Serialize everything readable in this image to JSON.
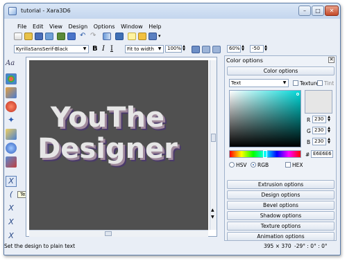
{
  "window": {
    "title": "tutorial - Xara3D6"
  },
  "menu": [
    "File",
    "Edit",
    "View",
    "Design",
    "Options",
    "Window",
    "Help"
  ],
  "format_bar": {
    "font": "KyrillaSansSerif-Black",
    "bold": "B",
    "italic": "I",
    "fit_mode": "Fit to width",
    "zoom": "100%",
    "tracking": "60%",
    "line_spacing": "-50"
  },
  "canvas": {
    "lines": [
      "YouThe",
      "Designer"
    ],
    "text_color": "#E6E6E6",
    "background": "#505050"
  },
  "tooltip": "Text",
  "statusbar": {
    "hint": "Set the design to plain text",
    "size": "395 × 370",
    "angles": "-29° : 0° : 0°"
  },
  "panel": {
    "title": "Color options",
    "section_header": "Color options",
    "target": "Text",
    "texture_label": "Texture",
    "tint_label": "Tint",
    "rgb": {
      "R": "230",
      "G": "230",
      "B": "230"
    },
    "hash_label": "#",
    "hex": "E6E6E6",
    "modes": [
      "HSV",
      "RGB"
    ],
    "hex_toggle": "HEX",
    "sections": [
      "Extrusion options",
      "Design options",
      "Bevel options",
      "Shadow options",
      "Texture options",
      "Animation options"
    ]
  },
  "tools": {
    "aa_label": "Aa"
  }
}
